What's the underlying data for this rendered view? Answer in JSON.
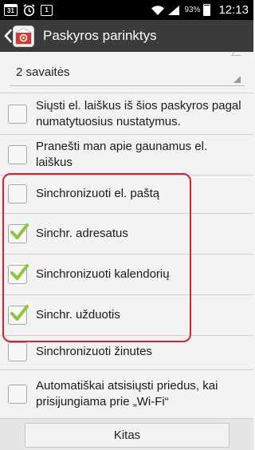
{
  "status_bar": {
    "calendar_day": "31",
    "notification_badge": "1",
    "battery_percent": "93%",
    "battery_level": 0.93,
    "time": "12:13",
    "icons": [
      "calendar-icon",
      "alarm-icon",
      "notification-icon",
      "wifi-icon",
      "signal-icon",
      "battery-icon"
    ]
  },
  "action_bar": {
    "title": "Paskyros parinktys",
    "back_icon": "chevron-left-icon",
    "app_icon": "email-app-icon"
  },
  "sync_period": {
    "value": "2 savaitės"
  },
  "options": [
    {
      "label": "Siųsti el. laiškus iš šios paskyros pagal numatytuosius nustatymus.",
      "checked": false
    },
    {
      "label": "Pranešti man apie gaunamus el. laiškus",
      "checked": false
    },
    {
      "label": "Sinchronizuoti el. paštą",
      "checked": false
    },
    {
      "label": "Sinchr. adresatus",
      "checked": true
    },
    {
      "label": "Sinchronizuoti kalendorių",
      "checked": true
    },
    {
      "label": "Sinchr. užduotis",
      "checked": true
    },
    {
      "label": "Sinchronizuoti žinutes",
      "checked": false
    },
    {
      "label": "Automatiškai atsisiųsti priedus, kai prisijungiama prie „Wi-Fi“",
      "checked": false
    }
  ],
  "bottom": {
    "next_label": "Kitas"
  },
  "colors": {
    "highlight": "#d8222b",
    "checkmark": "#8cc63f",
    "action_bar": "#3b3b3b"
  }
}
